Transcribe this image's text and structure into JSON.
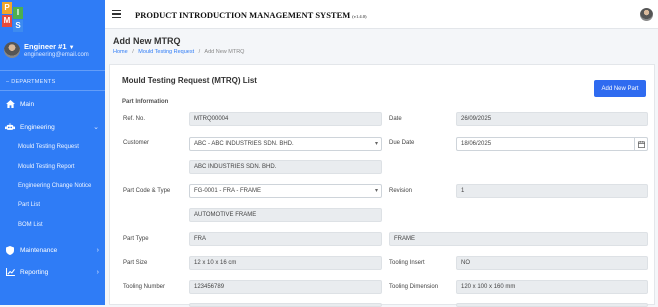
{
  "logo": {
    "letters": [
      "P",
      "I",
      "M",
      "S"
    ],
    "colors": [
      "#f0a52b",
      "#4caf50",
      "#e64a3c",
      "#3d8bf0"
    ]
  },
  "user": {
    "name": "Engineer #1",
    "email": "engineering@email.com"
  },
  "sidebar": {
    "departments_label": "DEPARTMENTS",
    "main": "Main",
    "engineering": "Engineering",
    "sub_items": [
      "Mould Testing Request",
      "Mould Testing Report",
      "Engineering Change Notice",
      "Part List",
      "BOM List"
    ],
    "maintenance": "Maintenance",
    "reporting": "Reporting"
  },
  "topbar": {
    "system_title": "PRODUCT INTRODUCTION MANAGEMENT SYSTEM",
    "version": "(v1.4.0)"
  },
  "page": {
    "title": "Add New MTRQ"
  },
  "breadcrumb": {
    "home": "Home",
    "parent": "Mould Testing Request",
    "current": "Add New MTRQ",
    "sep": "/"
  },
  "card": {
    "title": "Mould Testing Request (MTRQ) List",
    "add_button": "Add New Part",
    "section": "Part Information"
  },
  "form": {
    "ref_no": {
      "label": "Ref. No.",
      "value": "MTRQ00004"
    },
    "date": {
      "label": "Date",
      "value": "26/09/2025"
    },
    "customer": {
      "label": "Customer",
      "value": "ABC - ABC INDUSTRIES SDN. BHD.",
      "name": "ABC INDUSTRIES SDN. BHD."
    },
    "due_date": {
      "label": "Due Date",
      "value": "18/06/2025"
    },
    "part_code": {
      "label": "Part Code & Type",
      "value": "FG-0001 - FRA - FRAME",
      "name": "AUTOMOTIVE FRAME"
    },
    "revision": {
      "label": "Revision",
      "value": "1"
    },
    "part_type": {
      "label": "Part Type",
      "code": "FRA",
      "name": "FRAME"
    },
    "part_size": {
      "label": "Part Size",
      "value": "12 x 10 x 16 cm"
    },
    "tooling_insert": {
      "label": "Tooling Insert",
      "value": "NO"
    },
    "tooling_number": {
      "label": "Tooling Number",
      "value": "123456789"
    },
    "tooling_dimension": {
      "label": "Tooling Dimension",
      "value": "120 x 100 x 160 mm"
    }
  }
}
